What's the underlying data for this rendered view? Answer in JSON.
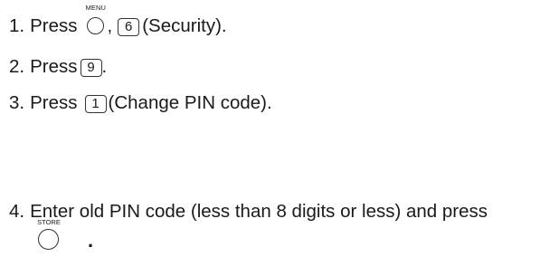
{
  "steps": [
    {
      "number": "1.",
      "text_before": "Press",
      "round_key_label": "MENU",
      "separator": ",",
      "key": "6",
      "text_after": "(Security)."
    },
    {
      "number": "2.",
      "text_before": "Press",
      "key": "9",
      "text_after": "."
    },
    {
      "number": "3.",
      "text_before": "Press",
      "key": "1",
      "text_after": "(Change PIN code)."
    },
    {
      "number": "4.",
      "text": "Enter old PIN code (less than 8 digits or less) and press",
      "round_key_label": "STORE",
      "text_after": "."
    }
  ]
}
